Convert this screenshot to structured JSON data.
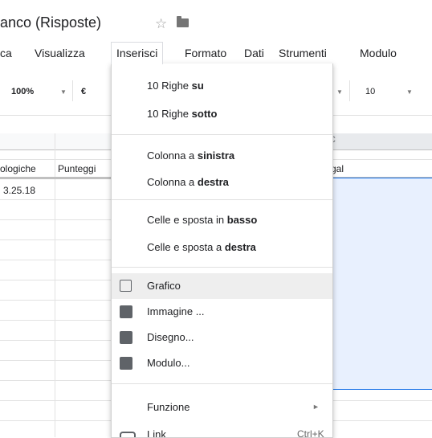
{
  "doc_title": "anco (Risposte)",
  "menubar": {
    "items": [
      {
        "label": "ca"
      },
      {
        "label": "Visualizza"
      },
      {
        "label": "Inserisci"
      },
      {
        "label": "Formato"
      },
      {
        "label": "Dati"
      },
      {
        "label": "Strumenti"
      },
      {
        "label": "Modulo"
      }
    ]
  },
  "toolbar": {
    "zoom": "100%",
    "currency": "€",
    "font_size": "10"
  },
  "grid": {
    "column_header_partial": "C",
    "headers": [
      "ologiche",
      "Punteggi",
      "gal"
    ],
    "cells": [
      "3.25.18"
    ]
  },
  "insert_menu": {
    "rows_above": {
      "text": "10 Righe ",
      "bold": "su"
    },
    "rows_below": {
      "text": "10 Righe ",
      "bold": "sotto"
    },
    "col_left": {
      "text": "Colonna a ",
      "bold": "sinistra"
    },
    "col_right": {
      "text": "Colonna a ",
      "bold": "destra"
    },
    "cells_down": {
      "text": "Celle e sposta in ",
      "bold": "basso"
    },
    "cells_right": {
      "text": "Celle e sposta a ",
      "bold": "destra"
    },
    "chart": "Grafico",
    "image": "Immagine ...",
    "drawing": "Disegno...",
    "form": "Modulo...",
    "function": "Funzione",
    "link": "Link",
    "link_shortcut": "Ctrl+K",
    "icons": [
      "chart-icon",
      "image-icon",
      "drawing-icon",
      "form-icon",
      "link-icon",
      "submenu-arrow-icon"
    ]
  }
}
